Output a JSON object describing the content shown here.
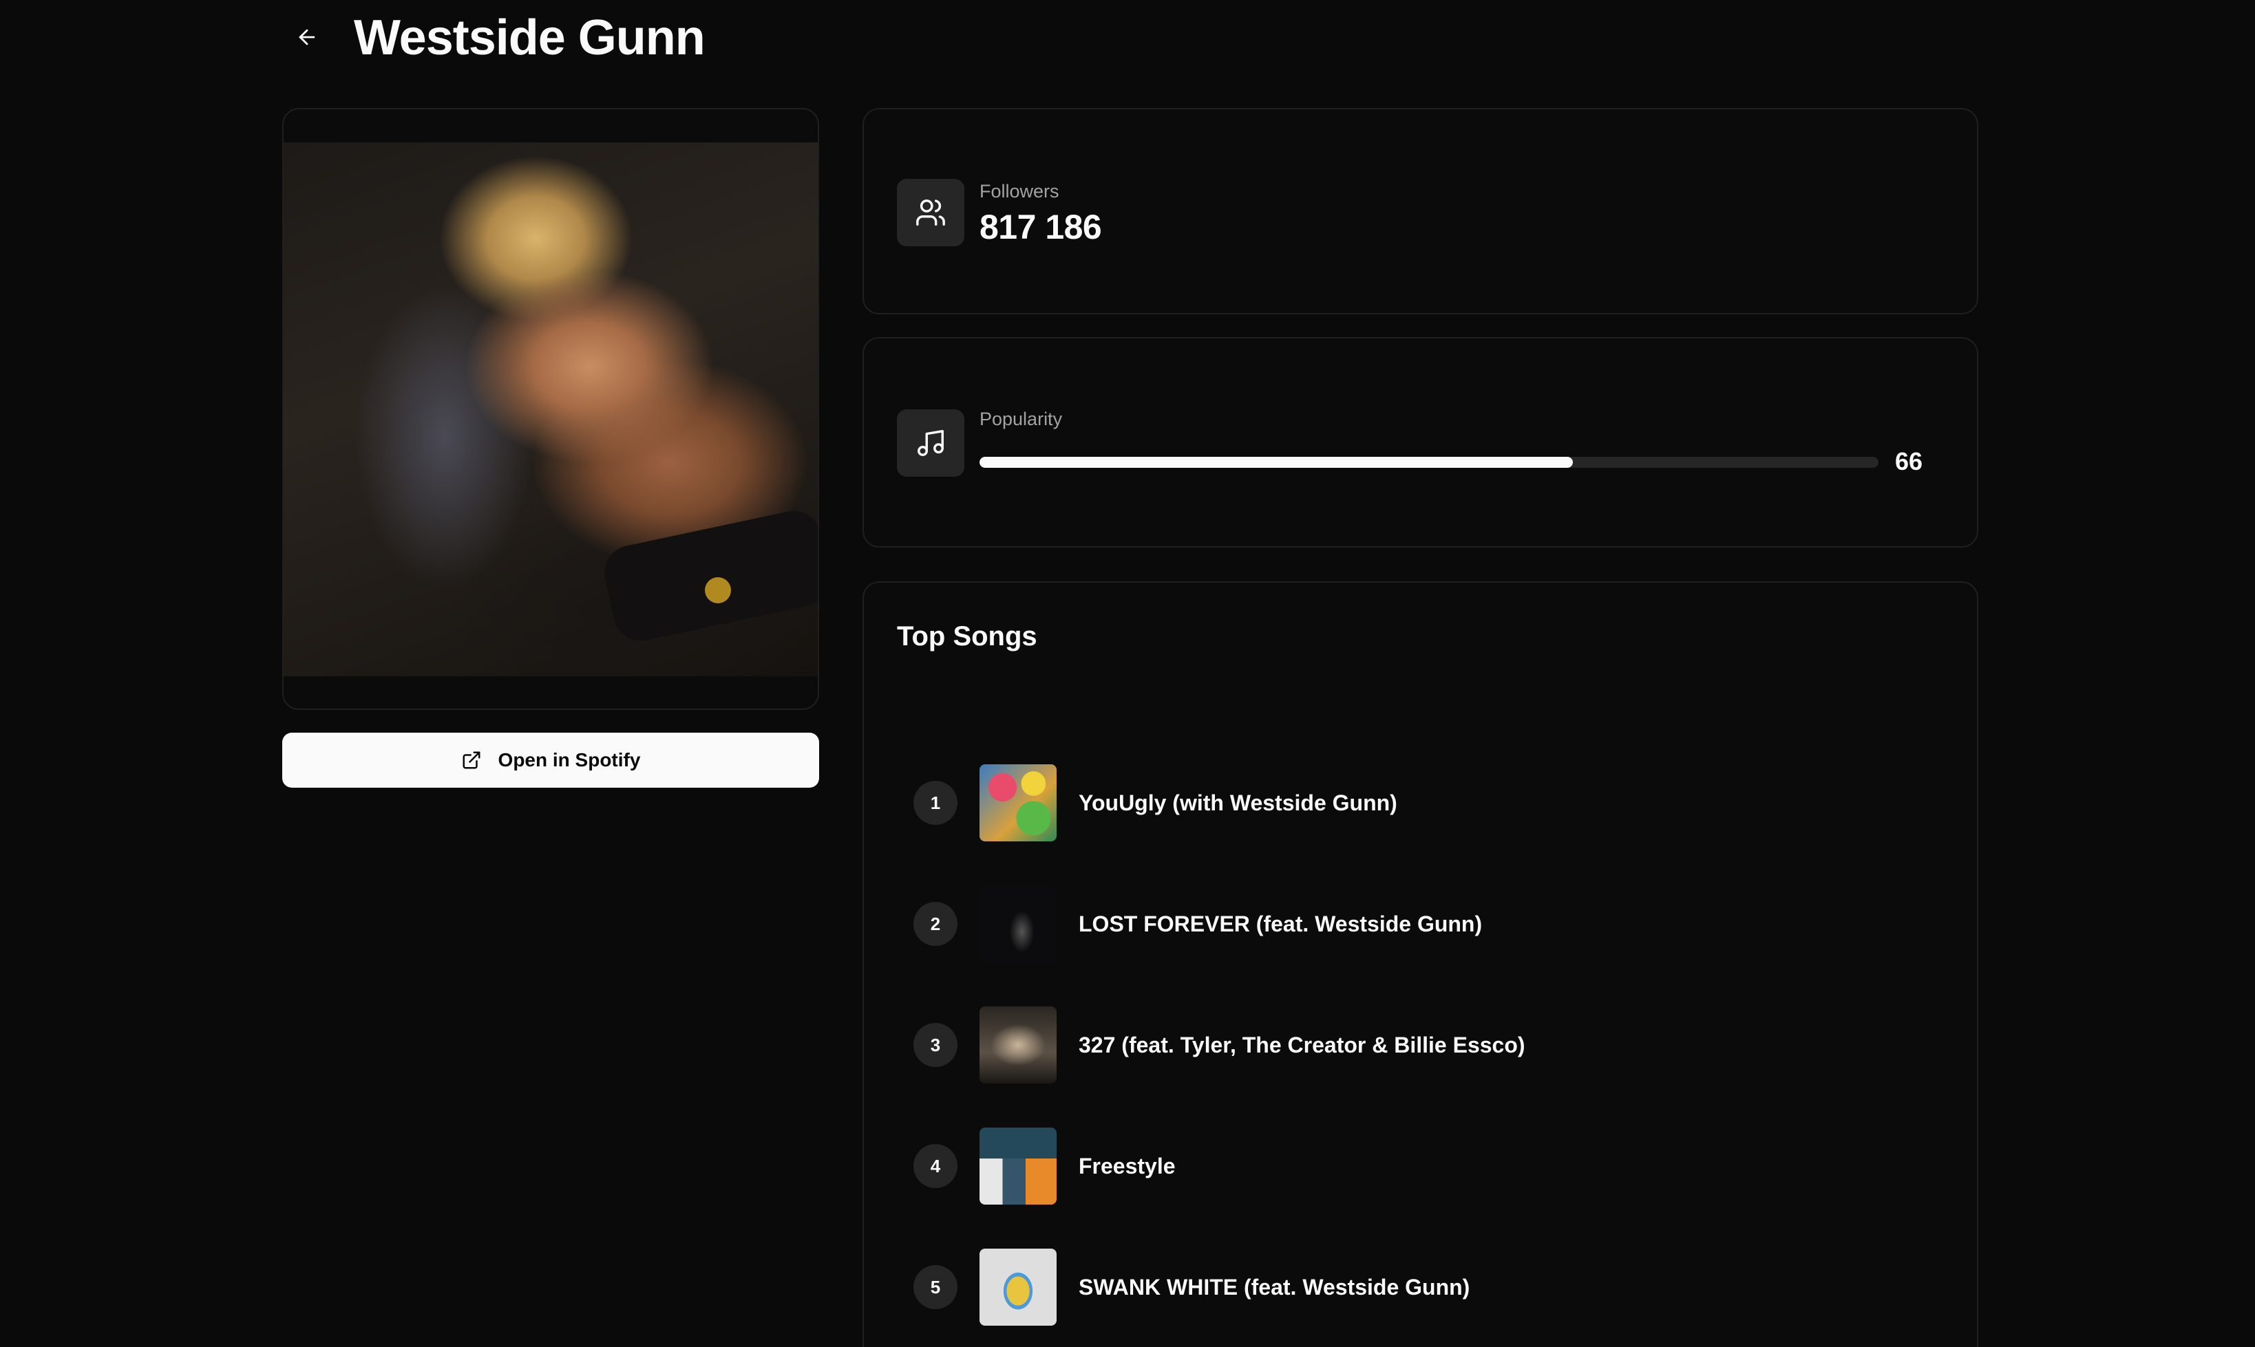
{
  "header": {
    "title": "Westside Gunn",
    "back_icon": "arrow-left-icon"
  },
  "artist": {
    "open_button_label": "Open in Spotify",
    "open_button_icon": "external-link-icon"
  },
  "followers": {
    "label": "Followers",
    "value": "817 186",
    "icon": "users-icon"
  },
  "popularity": {
    "label": "Popularity",
    "value": 66,
    "value_text": "66",
    "icon": "music-note-icon"
  },
  "top_songs": {
    "title": "Top Songs",
    "items": [
      {
        "rank": "1",
        "title": "YouUgly (with Westside Gunn)"
      },
      {
        "rank": "2",
        "title": "LOST FOREVER (feat. Westside Gunn)"
      },
      {
        "rank": "3",
        "title": "327 (feat. Tyler, The Creator & Billie Essco)"
      },
      {
        "rank": "4",
        "title": "Freestyle"
      },
      {
        "rank": "5",
        "title": "SWANK WHITE (feat. Westside Gunn)"
      }
    ]
  },
  "colors": {
    "background": "#0a0a0a",
    "card_border": "#1f1f1f",
    "muted_surface": "#262626",
    "text": "#fafafa",
    "muted_text": "#a3a3a3"
  }
}
